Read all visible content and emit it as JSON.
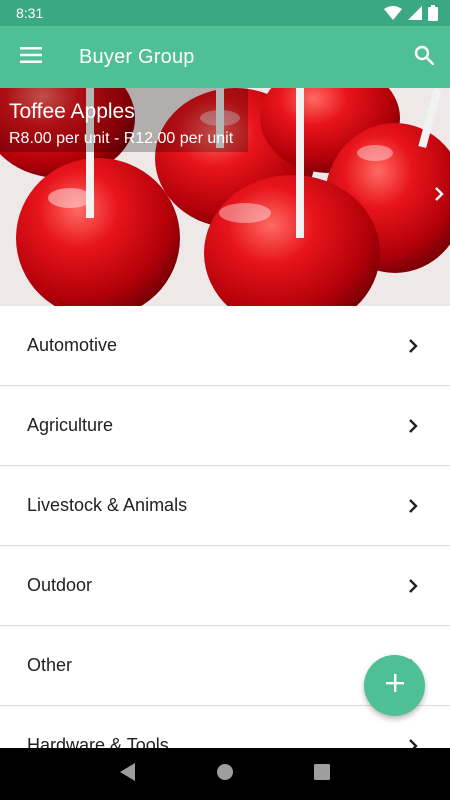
{
  "status_bar": {
    "time": "8:31",
    "icons": [
      "wifi-icon",
      "signal-icon",
      "battery-icon"
    ]
  },
  "app_bar": {
    "title": "Buyer Group",
    "menu_icon": "menu-icon",
    "search_icon": "search-icon"
  },
  "banner": {
    "title": "Toffee Apples",
    "subtitle": "R8.00 per unit - R12.00 per unit",
    "next_icon": "chevron-right-icon"
  },
  "categories": [
    {
      "label": "Automotive"
    },
    {
      "label": "Agriculture"
    },
    {
      "label": "Livestock & Animals"
    },
    {
      "label": "Outdoor"
    },
    {
      "label": "Other"
    },
    {
      "label": "Hardware & Tools"
    }
  ],
  "fab": {
    "icon": "plus-icon"
  },
  "nav_bar": {
    "icons": [
      "back-icon",
      "home-icon",
      "recents-icon"
    ]
  },
  "colors": {
    "primary": "#4fc095",
    "status_bar": "#3aa882",
    "text": "#212121",
    "divider": "#dcdcdc"
  }
}
